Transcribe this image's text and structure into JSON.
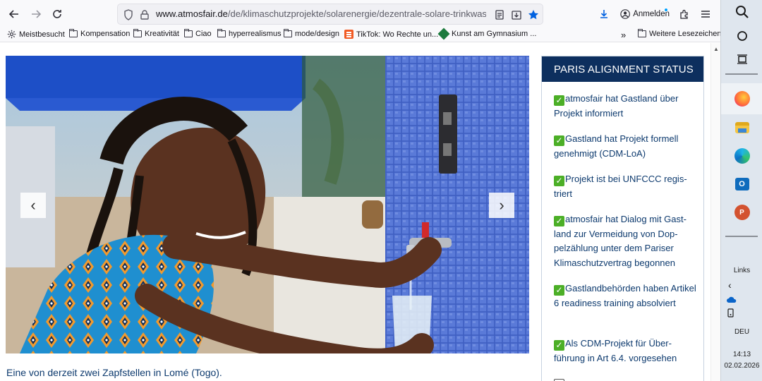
{
  "browser": {
    "url_domain": "www.atmosfair.de",
    "url_path": "/de/klimaschutzprojekte/solarenergie/dezentrale-solare-trinkwassernetze-",
    "signin_label": "Anmelden"
  },
  "bookmarks": [
    {
      "label": "Meistbesucht",
      "icon": "gear-icon"
    },
    {
      "label": "Kompensation",
      "icon": "folder-icon"
    },
    {
      "label": "Kreativität",
      "icon": "folder-icon"
    },
    {
      "label": "Ciao",
      "icon": "folder-icon"
    },
    {
      "label": "hyperrealismus",
      "icon": "folder-icon"
    },
    {
      "label": "mode/design",
      "icon": "folder-icon"
    },
    {
      "label": "TikTok: Wo Rechte un...",
      "icon": "bookmark-page-icon"
    },
    {
      "label": "Kunst am Gymnasium ...",
      "icon": "bookmark-page-icon"
    },
    {
      "label": "Weitere Lesezeichen",
      "icon": "folder-icon"
    }
  ],
  "page": {
    "caption": "Eine von derzeit zwei Zapfstellen in Lomé (Togo).",
    "panel_title": "PARIS ALIGNMENT STATUS",
    "status_items": [
      "atmosfair hat Gastland über Projekt informiert",
      "Gastland hat Projekt formell genehmigt (CDM-LoA)",
      "Projekt ist bei UNFCCC regis­triert",
      "atmosfair hat Dialog mit Gast­land zur Vermeidung von Dop­pelzählung unter dem Pariser Klimaschutzvertrag begonnen",
      "Gastlandbehörden haben Ar­tikel 6 readiness training absol­viert",
      "Als CDM-Projekt für Über­führung in Art 6.4. vorgesehen"
    ],
    "colors": {
      "panel_header": "#0d2f5e",
      "link_text": "#0d3a6e",
      "check": "#4caf27"
    }
  },
  "taskbar": {
    "links_label": "Links",
    "language": "DEU",
    "time": "14:13",
    "date": "02.02.2026"
  }
}
